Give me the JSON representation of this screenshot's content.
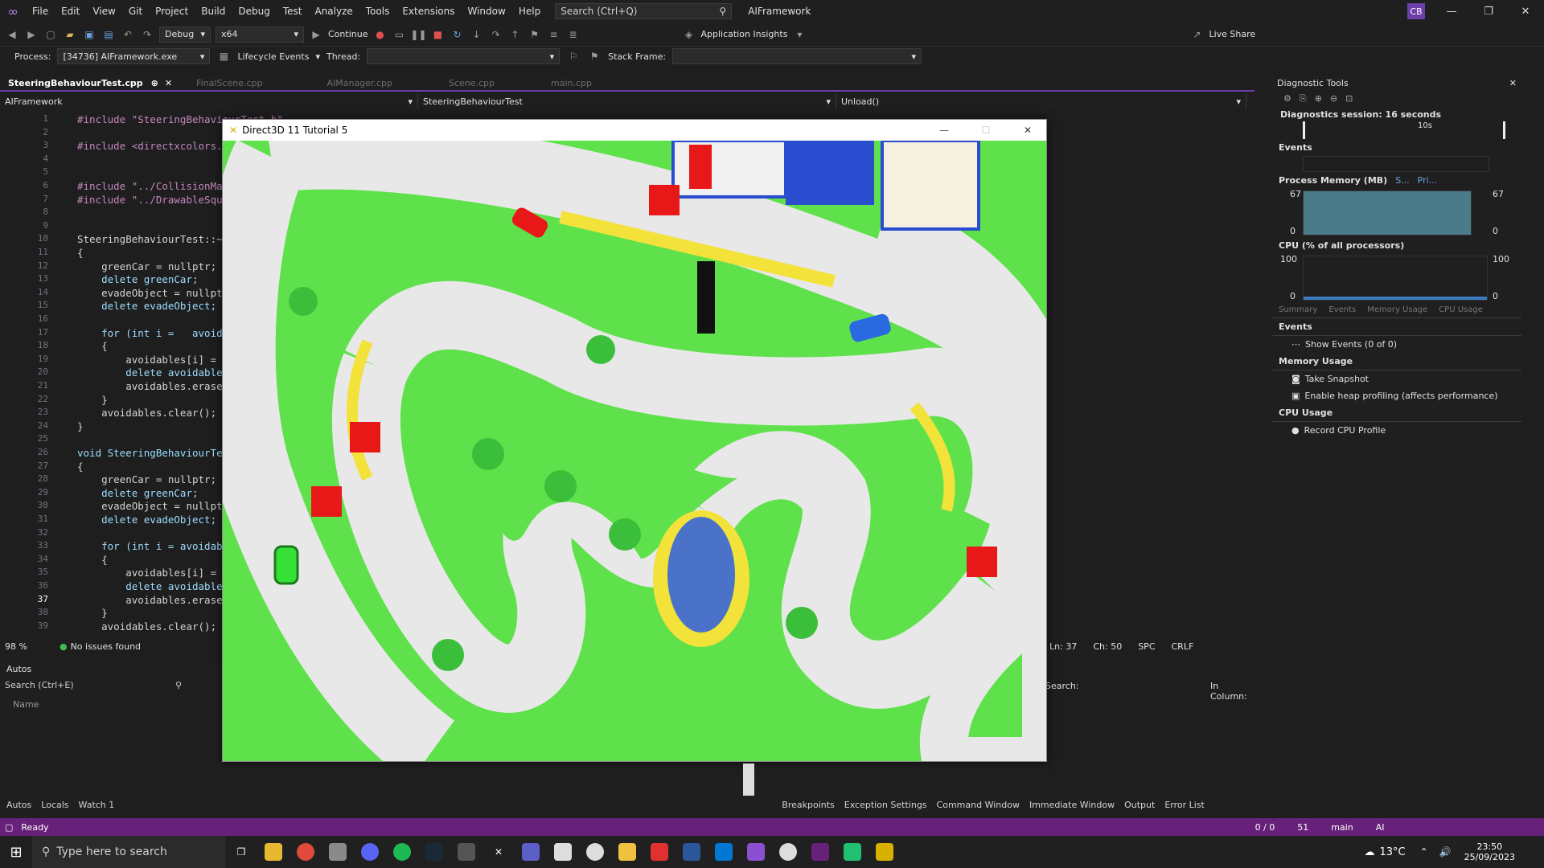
{
  "menubar": {
    "items": [
      "File",
      "Edit",
      "View",
      "Git",
      "Project",
      "Build",
      "Debug",
      "Test",
      "Analyze",
      "Tools",
      "Extensions",
      "Window",
      "Help"
    ],
    "search_placeholder": "Search (Ctrl+Q)",
    "app_name": "AIFramework",
    "user_initials": "CB"
  },
  "toolbar": {
    "config": "Debug",
    "platform": "x64",
    "continue_label": "Continue",
    "app_insights": "Application Insights",
    "live_share": "Live Share"
  },
  "debugbar": {
    "process_label": "Process:",
    "process_value": "[34736] AIFramework.exe",
    "lifecycle": "Lifecycle Events",
    "thread_label": "Thread:",
    "stackframe_label": "Stack Frame:"
  },
  "tabs": [
    {
      "label": "SteeringBehaviourTest.cpp",
      "active": true
    },
    {
      "label": "FinalScene.cpp",
      "active": false
    },
    {
      "label": "AIManager.cpp",
      "active": false
    },
    {
      "label": "Scene.cpp",
      "active": false
    },
    {
      "label": "main.cpp",
      "active": false
    }
  ],
  "navbar": {
    "project": "AIFramework",
    "scope": "SteeringBehaviourTest",
    "member": "Unload()"
  },
  "code_lines": [
    {
      "n": "1",
      "text": "#include \"SteeringBehaviourTest.h\""
    },
    {
      "n": "2",
      "text": ""
    },
    {
      "n": "3",
      "text": "#include <directxcolors."
    },
    {
      "n": "4",
      "text": ""
    },
    {
      "n": "5",
      "text": ""
    },
    {
      "n": "6",
      "text": "#include \"../CollisionMa"
    },
    {
      "n": "7",
      "text": "#include \"../DrawableSqu"
    },
    {
      "n": "8",
      "text": ""
    },
    {
      "n": "9",
      "text": ""
    },
    {
      "n": "10",
      "text": "SteeringBehaviourTest::~"
    },
    {
      "n": "11",
      "text": "{"
    },
    {
      "n": "12",
      "text": "    greenCar = nullptr;"
    },
    {
      "n": "13",
      "text": "    delete greenCar;"
    },
    {
      "n": "14",
      "text": "    evadeObject = nullpt"
    },
    {
      "n": "15",
      "text": "    delete evadeObject;"
    },
    {
      "n": "16",
      "text": ""
    },
    {
      "n": "17",
      "text": "    for (int i =   avoida"
    },
    {
      "n": "18",
      "text": "    {"
    },
    {
      "n": "19",
      "text": "        avoidables[i] ="
    },
    {
      "n": "20",
      "text": "        delete avoidable"
    },
    {
      "n": "21",
      "text": "        avoidables.erase"
    },
    {
      "n": "22",
      "text": "    }"
    },
    {
      "n": "23",
      "text": "    avoidables.clear();"
    },
    {
      "n": "24",
      "text": "}"
    },
    {
      "n": "25",
      "text": ""
    },
    {
      "n": "26",
      "text": "void SteeringBehaviourTe"
    },
    {
      "n": "27",
      "text": "{"
    },
    {
      "n": "28",
      "text": "    greenCar = nullptr;"
    },
    {
      "n": "29",
      "text": "    delete greenCar;"
    },
    {
      "n": "30",
      "text": "    evadeObject = nullpt"
    },
    {
      "n": "31",
      "text": "    delete evadeObject;"
    },
    {
      "n": "32",
      "text": ""
    },
    {
      "n": "33",
      "text": "    for (int i = avoidab"
    },
    {
      "n": "34",
      "text": "    {"
    },
    {
      "n": "35",
      "text": "        avoidables[i] ="
    },
    {
      "n": "36",
      "text": "        delete avoidable"
    },
    {
      "n": "37",
      "text": "        avoidables.erase"
    },
    {
      "n": "38",
      "text": "    }"
    },
    {
      "n": "39",
      "text": "    avoidables.clear();"
    }
  ],
  "editor_status": {
    "zoom": "98 %",
    "issues": "No issues found",
    "ln": "Ln: 37",
    "ch": "Ch: 50",
    "spc": "SPC",
    "crlf": "CRLF"
  },
  "autos": {
    "title": "Autos",
    "search_placeholder": "Search (Ctrl+E)",
    "col_name": "Name",
    "search_right_label": "Search:",
    "in_column_label": "In Column:"
  },
  "bottom_left_tabs": [
    "Autos",
    "Locals",
    "Watch 1"
  ],
  "bottom_right_tabs": [
    "Breakpoints",
    "Exception Settings",
    "Command Window",
    "Immediate Window",
    "Output",
    "Error List"
  ],
  "statusbar": {
    "ready": "Ready",
    "sync": "0 / 0",
    "pencil": "51",
    "branch": "main",
    "ai": "AI"
  },
  "diag": {
    "title": "Diagnostic Tools",
    "session": "Diagnostics session: 16 seconds",
    "timeline_mark": "10s",
    "events_h": "Events",
    "memory_h": "Process Memory (MB)",
    "memory_legend1": "S...",
    "memory_legend2": "Pri...",
    "mem_max": "67",
    "mem_min": "0",
    "cpu_h": "CPU (% of all processors)",
    "cpu_max": "100",
    "cpu_min": "0",
    "tabs": [
      "Summary",
      "Events",
      "Memory Usage",
      "CPU Usage"
    ],
    "section_events": "Events",
    "show_events": "Show Events (0 of 0)",
    "section_memory": "Memory Usage",
    "take_snapshot": "Take Snapshot",
    "heap_profiling": "Enable heap profiling (affects performance)",
    "section_cpu": "CPU Usage",
    "record_cpu": "Record CPU Profile"
  },
  "game_window": {
    "title": "Direct3D 11 Tutorial 5"
  },
  "taskbar": {
    "search_placeholder": "Type here to search",
    "temperature": "13°C",
    "time": "23:50",
    "date": "25/09/2023"
  },
  "colors": {
    "accent": "#68217a",
    "grass": "#5ee14a",
    "road": "#e8e8e8"
  }
}
